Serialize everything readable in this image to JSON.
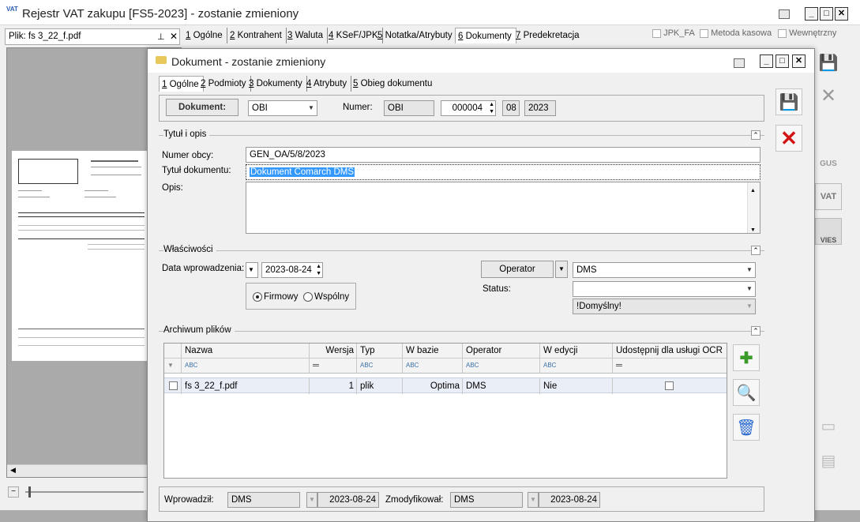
{
  "main_window": {
    "title": "Rejestr VAT zakupu [FS5-2023] - zostanie zmieniony",
    "file_label": "Plik: fs 3_22_f.pdf",
    "tabs": [
      {
        "num": "1",
        "label": " Ogólne"
      },
      {
        "num": "2",
        "label": " Kontrahent"
      },
      {
        "num": "3",
        "label": " Waluta"
      },
      {
        "num": "4",
        "label": " KSeF/JPK"
      },
      {
        "num": "5",
        "label": " Notatka/Atrybuty"
      },
      {
        "num": "6",
        "label": " Dokumenty"
      },
      {
        "num": "7",
        "label": " Predekretacja"
      }
    ],
    "checks": {
      "jpk_fa": "JPK_FA",
      "metoda_kasowa": "Metoda kasowa",
      "wewnetrzny": "Wewnętrzny"
    }
  },
  "dialog": {
    "title": "Dokument - zostanie zmieniony",
    "tabs": [
      {
        "num": "1",
        "label": " Ogólne"
      },
      {
        "num": "2",
        "label": " Podmioty"
      },
      {
        "num": "3",
        "label": " Dokumenty"
      },
      {
        "num": "4",
        "label": " Atrybuty"
      },
      {
        "num": "5",
        "label": " Obieg dokumentu"
      }
    ],
    "doc": {
      "button": "Dokument:",
      "type": "OBI",
      "numer_label": "Numer:",
      "numer_prefix": "OBI",
      "numer_value": "000004",
      "month": "08",
      "year": "2023"
    },
    "title_section": {
      "title": "Tytuł i opis",
      "numer_obcy_label": "Numer obcy:",
      "numer_obcy": "GEN_OA/5/8/2023",
      "tytul_label": "Tytuł dokumentu:",
      "tytul": "Dokument Comarch DMS",
      "opis_label": "Opis:",
      "opis": ""
    },
    "props": {
      "title": "Właściwości",
      "data_label": "Data wprowadzenia:",
      "data": "2023-08-24",
      "radio_firmowy": "Firmowy",
      "radio_wspolny": "Wspólny",
      "operator_button": "Operator",
      "operator_value": "DMS",
      "status_label": "Status:",
      "status_value": "",
      "default_value": "!Domyślny!"
    },
    "archive": {
      "title": "Archiwum plików",
      "columns": [
        "Nazwa",
        "Wersja",
        "Typ",
        "W bazie",
        "Operator",
        "W edycji",
        "Udostępnij dla usługi OCR"
      ],
      "filter_glyph": "ABC",
      "filter_eq": "═",
      "rows": [
        {
          "nazwa": "fs 3_22_f.pdf",
          "wersja": "1",
          "typ": "plik",
          "w_bazie": "Optima",
          "operator": "DMS",
          "w_edycji": "Nie"
        }
      ]
    },
    "footer": {
      "wprowadzil_label": "Wprowadził:",
      "wprowadzil": "DMS",
      "wprowadzil_date": "2023-08-24",
      "zmodyfikowal_label": "Zmodyfikował:",
      "zmodyfikowal": "DMS",
      "zmodyfikowal_date": "2023-08-24"
    }
  },
  "colors": {
    "accent": "#3399ff",
    "selection": "#3399ff",
    "red": "#d21414",
    "blue": "#1f5fbf"
  }
}
